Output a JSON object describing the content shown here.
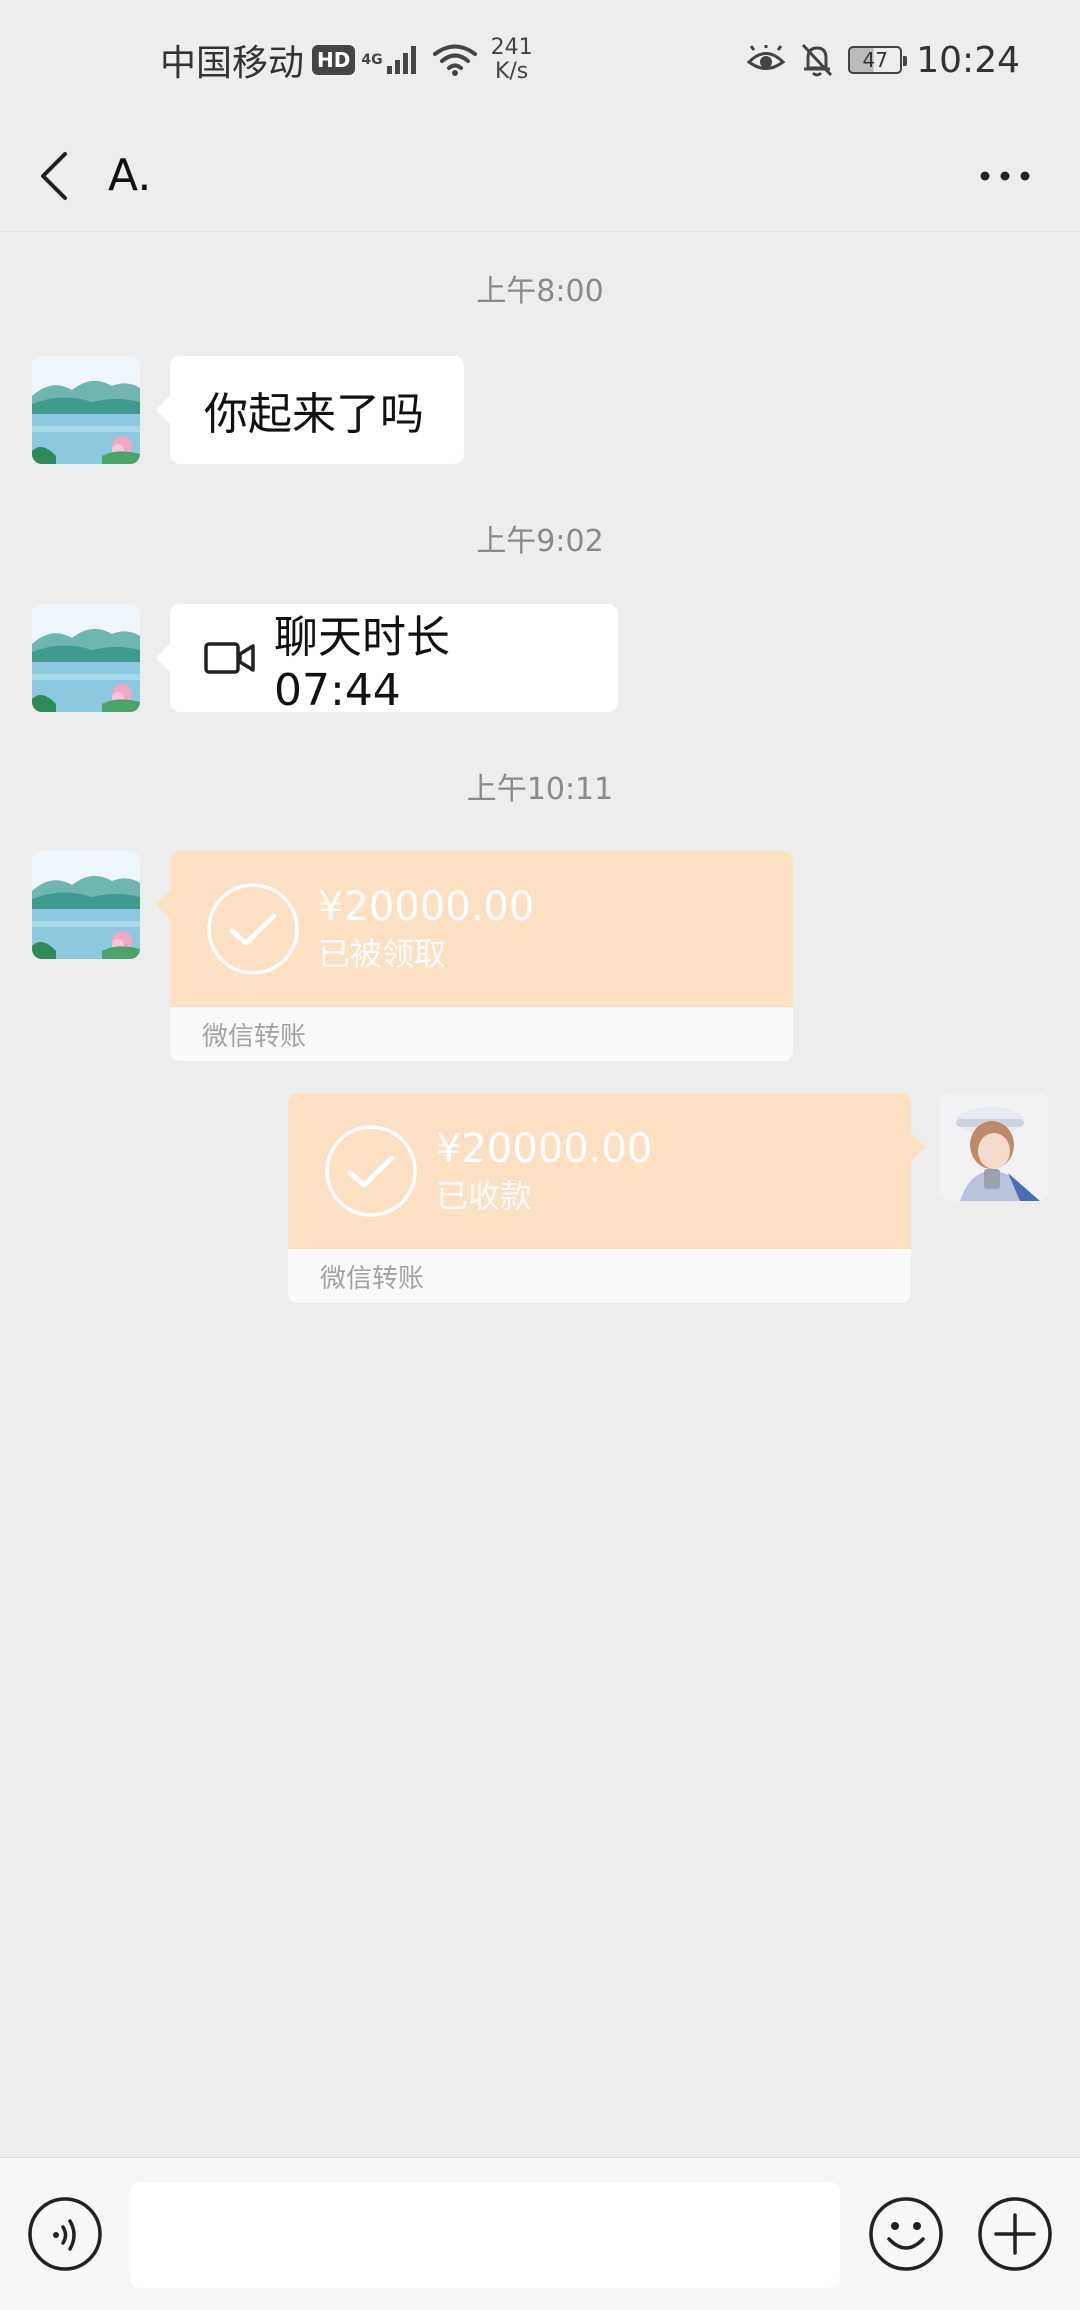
{
  "status_bar": {
    "carrier": "中国移动",
    "hd": "HD",
    "network_type": "4G",
    "speed_value": "241",
    "speed_unit": "K/s",
    "battery": "47",
    "time": "10:24"
  },
  "header": {
    "title": "A."
  },
  "messages": [
    {
      "timestamp": "上午8:00",
      "text": "你起来了吗"
    },
    {
      "timestamp": "上午9:02",
      "text": "聊天时长 07:44"
    },
    {
      "timestamp": "上午10:11"
    }
  ],
  "transfers": [
    {
      "amount": "¥20000.00",
      "status": "已被领取",
      "footer": "微信转账"
    },
    {
      "amount": "¥20000.00",
      "status": "已收款",
      "footer": "微信转账"
    }
  ],
  "colors": {
    "background": "#ededed",
    "transfer_accent": "#fce0c1",
    "bubble": "#ffffff"
  },
  "icons": {
    "back": "chevron-left-icon",
    "more": "more-dots-icon",
    "video": "video-camera-icon",
    "check": "check-circle-icon",
    "voice": "voice-icon",
    "emoji": "emoji-icon",
    "plus": "plus-icon"
  }
}
